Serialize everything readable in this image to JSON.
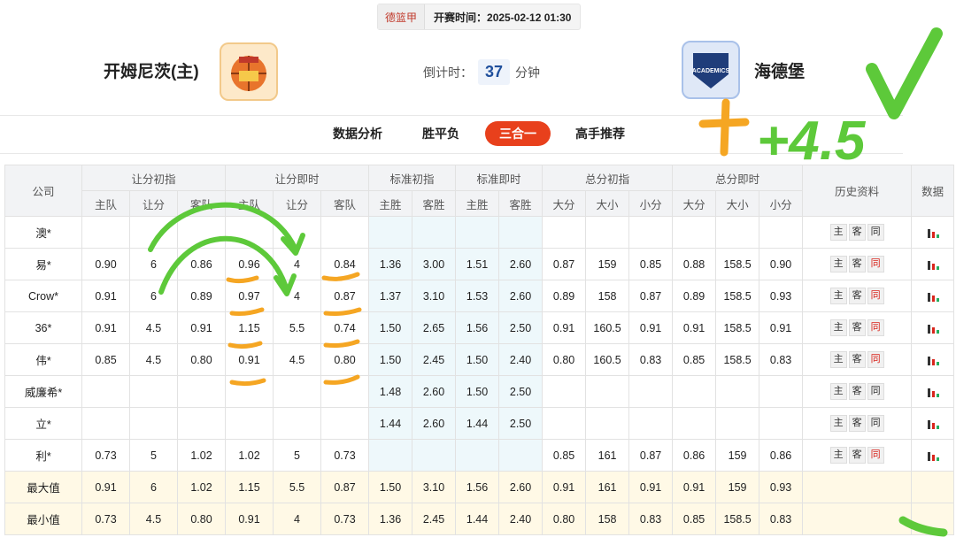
{
  "header": {
    "league": "德篮甲",
    "start_time": "开赛时间：2025-02-12 01:30",
    "home_team": "开姆尼茨(主)",
    "away_team": "海德堡",
    "countdown_label": "倒计时：",
    "countdown_value": "37",
    "countdown_unit": "分钟",
    "away_logo_text": "ACADEMICS"
  },
  "tabs": [
    "数据分析",
    "胜平负",
    "三合一",
    "高手推荐"
  ],
  "active_tab": "三合一",
  "table": {
    "group_headers": [
      "公司",
      "让分初指",
      "让分即时",
      "标准初指",
      "标准即时",
      "总分初指",
      "总分即时",
      "历史资料",
      "数据"
    ],
    "sub_headers": [
      "主队",
      "让分",
      "客队",
      "主队",
      "让分",
      "客队",
      "主胜",
      "客胜",
      "主胜",
      "客胜",
      "大分",
      "大小",
      "小分",
      "大分",
      "大小",
      "小分"
    ],
    "history_buttons": [
      "主",
      "客",
      "同"
    ],
    "rows": [
      {
        "company": "澳*",
        "hi": [
          "",
          "",
          ""
        ],
        "hc": [
          "",
          "",
          ""
        ],
        "si": [
          "",
          ""
        ],
        "sc": [
          "",
          ""
        ],
        "ti": [
          "",
          "",
          ""
        ],
        "tc": [
          "",
          "",
          ""
        ],
        "same_red": false
      },
      {
        "company": "易*",
        "hi": [
          "0.90",
          "6",
          "0.86"
        ],
        "hc": [
          "0.96",
          "4",
          "0.84"
        ],
        "si": [
          "1.36",
          "3.00"
        ],
        "sc": [
          "1.51",
          "2.60"
        ],
        "ti": [
          "0.87",
          "159",
          "0.85"
        ],
        "tc": [
          "0.88",
          "158.5",
          "0.90"
        ],
        "same_red": true
      },
      {
        "company": "Crow*",
        "hi": [
          "0.91",
          "6",
          "0.89"
        ],
        "hc": [
          "0.97",
          "4",
          "0.87"
        ],
        "si": [
          "1.37",
          "3.10"
        ],
        "sc": [
          "1.53",
          "2.60"
        ],
        "ti": [
          "0.89",
          "158",
          "0.87"
        ],
        "tc": [
          "0.89",
          "158.5",
          "0.93"
        ],
        "same_red": true
      },
      {
        "company": "36*",
        "hi": [
          "0.91",
          "4.5",
          "0.91"
        ],
        "hc": [
          "1.15",
          "5.5",
          "0.74"
        ],
        "si": [
          "1.50",
          "2.65"
        ],
        "sc": [
          "1.56",
          "2.50"
        ],
        "ti": [
          "0.91",
          "160.5",
          "0.91"
        ],
        "tc": [
          "0.91",
          "158.5",
          "0.91"
        ],
        "same_red": true
      },
      {
        "company": "伟*",
        "hi": [
          "0.85",
          "4.5",
          "0.80"
        ],
        "hc": [
          "0.91",
          "4.5",
          "0.80"
        ],
        "si": [
          "1.50",
          "2.45"
        ],
        "sc": [
          "1.50",
          "2.40"
        ],
        "ti": [
          "0.80",
          "160.5",
          "0.83"
        ],
        "tc": [
          "0.85",
          "158.5",
          "0.83"
        ],
        "same_red": true
      },
      {
        "company": "威廉希*",
        "hi": [
          "",
          "",
          ""
        ],
        "hc": [
          "",
          "",
          ""
        ],
        "si": [
          "1.48",
          "2.60"
        ],
        "sc": [
          "1.50",
          "2.50"
        ],
        "ti": [
          "",
          "",
          ""
        ],
        "tc": [
          "",
          "",
          ""
        ],
        "same_red": false
      },
      {
        "company": "立*",
        "hi": [
          "",
          "",
          ""
        ],
        "hc": [
          "",
          "",
          ""
        ],
        "si": [
          "1.44",
          "2.60"
        ],
        "sc": [
          "1.44",
          "2.50"
        ],
        "ti": [
          "",
          "",
          ""
        ],
        "tc": [
          "",
          "",
          ""
        ],
        "same_red": false
      },
      {
        "company": "利*",
        "hi": [
          "0.73",
          "5",
          "1.02"
        ],
        "hc": [
          "1.02",
          "5",
          "0.73"
        ],
        "si": [
          "",
          ""
        ],
        "sc": [
          "",
          ""
        ],
        "ti": [
          "0.85",
          "161",
          "0.87"
        ],
        "tc": [
          "0.86",
          "159",
          "0.86"
        ],
        "same_red": true
      }
    ],
    "summary": [
      {
        "company": "最大值",
        "hi": [
          "0.91",
          "6",
          "1.02"
        ],
        "hc": [
          "1.15",
          "5.5",
          "0.87"
        ],
        "si": [
          "1.50",
          "3.10"
        ],
        "sc": [
          "1.56",
          "2.60"
        ],
        "ti": [
          "0.91",
          "161",
          "0.91"
        ],
        "tc": [
          "0.91",
          "159",
          "0.93"
        ]
      },
      {
        "company": "最小值",
        "hi": [
          "0.73",
          "4.5",
          "0.80"
        ],
        "hc": [
          "0.91",
          "4",
          "0.73"
        ],
        "si": [
          "1.36",
          "2.45"
        ],
        "sc": [
          "1.44",
          "2.40"
        ],
        "ti": [
          "0.80",
          "158",
          "0.83"
        ],
        "tc": [
          "0.85",
          "158.5",
          "0.83"
        ]
      }
    ]
  },
  "annotations": {
    "handwritten_note": "+4.5",
    "green_color": "#5dc93a",
    "orange_color": "#f5a623"
  }
}
